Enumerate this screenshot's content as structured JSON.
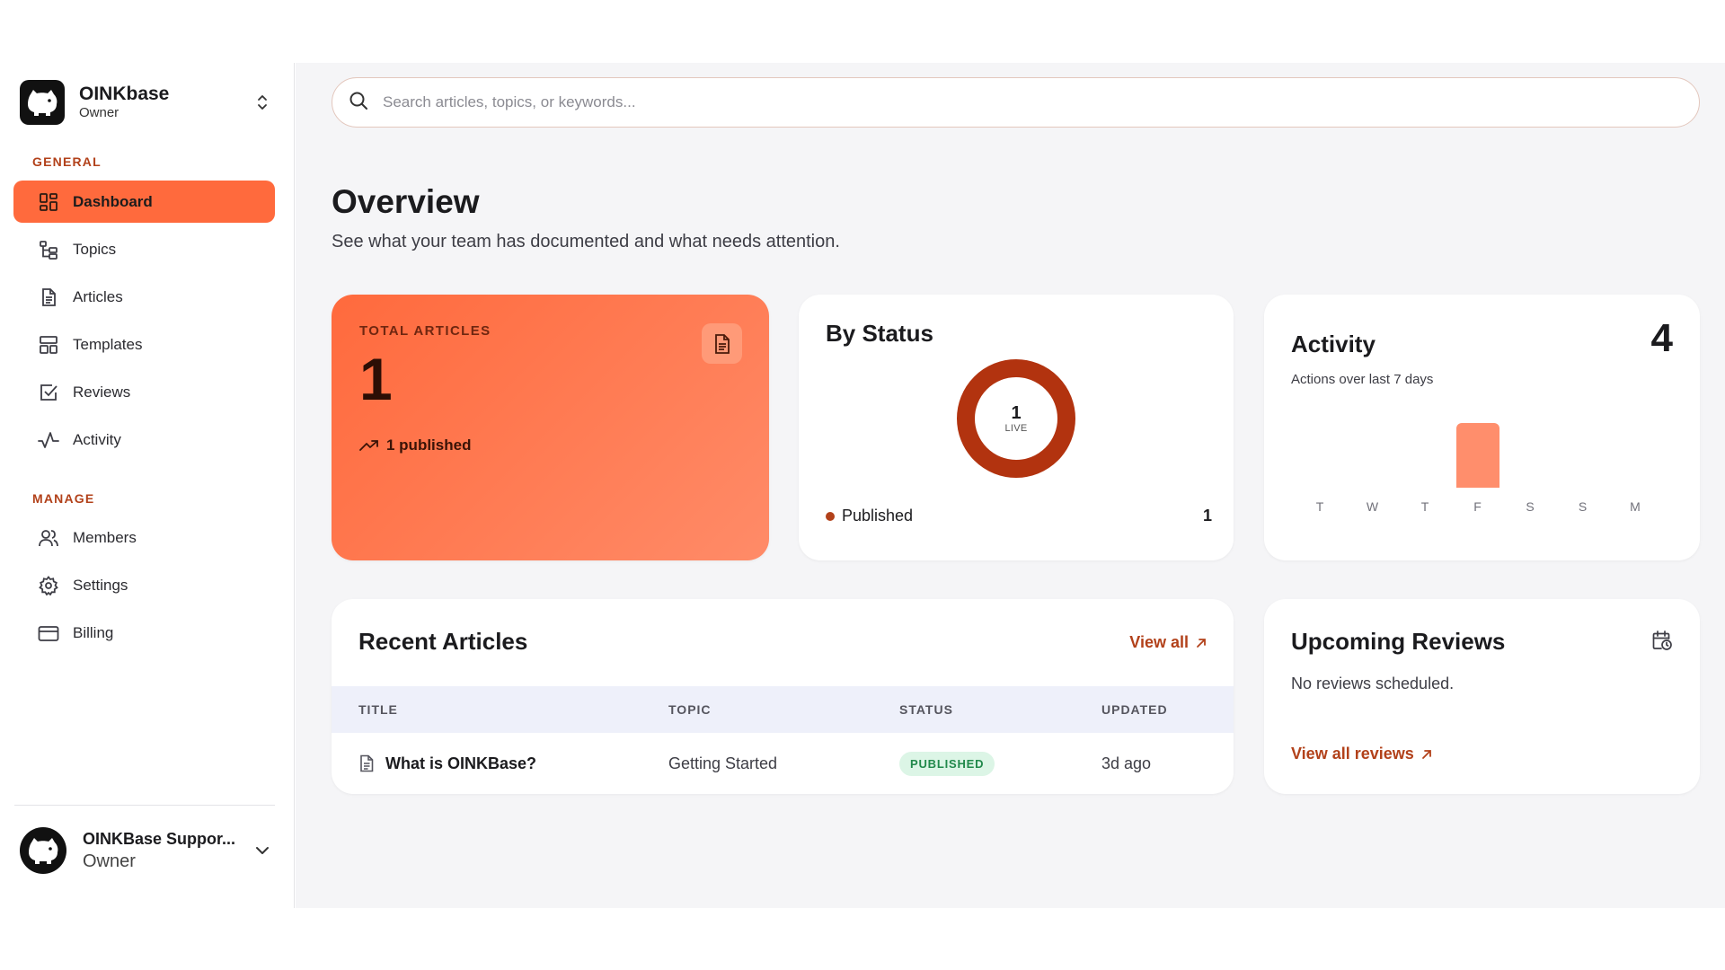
{
  "sidebar": {
    "brand": {
      "name": "OINKbase",
      "role": "Owner"
    },
    "sections": {
      "general": "GENERAL",
      "manage": "MANAGE"
    },
    "general_items": [
      {
        "label": "Dashboard",
        "icon": "dashboard-icon",
        "active": true
      },
      {
        "label": "Topics",
        "icon": "topics-icon"
      },
      {
        "label": "Articles",
        "icon": "article-icon"
      },
      {
        "label": "Templates",
        "icon": "templates-icon"
      },
      {
        "label": "Reviews",
        "icon": "checkbox-icon"
      },
      {
        "label": "Activity",
        "icon": "pulse-icon"
      }
    ],
    "manage_items": [
      {
        "label": "Members",
        "icon": "users-icon"
      },
      {
        "label": "Settings",
        "icon": "gear-icon"
      },
      {
        "label": "Billing",
        "icon": "credit-card-icon"
      }
    ],
    "user": {
      "name": "OINKBase Suppor...",
      "role": "Owner"
    }
  },
  "search": {
    "placeholder": "Search articles, topics, or keywords..."
  },
  "header": {
    "title": "Overview",
    "subtitle": "See what your team has documented and what needs attention."
  },
  "total_articles": {
    "label": "TOTAL ARTICLES",
    "value": "1",
    "trend": "1 published"
  },
  "by_status": {
    "title": "By Status",
    "center_value": "1",
    "center_label": "LIVE",
    "legend": [
      {
        "label": "Published",
        "count": "1",
        "color": "#b2411a"
      }
    ]
  },
  "activity": {
    "title": "Activity",
    "total": "4",
    "subtitle": "Actions over last 7 days"
  },
  "chart_data": {
    "type": "bar",
    "categories": [
      "T",
      "W",
      "T",
      "F",
      "S",
      "S",
      "M"
    ],
    "values": [
      0,
      0,
      0,
      4,
      0,
      0,
      0
    ],
    "ylim": [
      0,
      4
    ],
    "color": "#ff8e6c"
  },
  "recent_articles": {
    "title": "Recent Articles",
    "view_all": "View all",
    "columns": [
      "TITLE",
      "TOPIC",
      "STATUS",
      "UPDATED"
    ],
    "rows": [
      {
        "title": "What is OINKBase?",
        "topic": "Getting Started",
        "status": "PUBLISHED",
        "updated": "3d ago"
      }
    ]
  },
  "upcoming_reviews": {
    "title": "Upcoming Reviews",
    "empty": "No reviews scheduled.",
    "view_all": "View all reviews"
  },
  "colors": {
    "accent": "#ff6a3d",
    "accent_dark": "#b2411a",
    "success_bg": "#dcf5e6",
    "success_text": "#21894b"
  }
}
